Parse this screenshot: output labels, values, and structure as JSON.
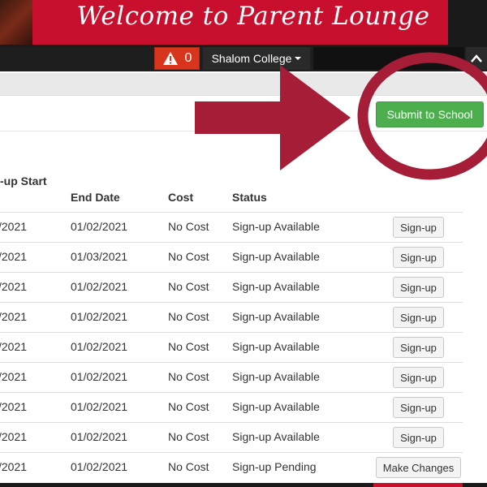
{
  "banner": {
    "title": "Welcome to Parent Lounge"
  },
  "topnav": {
    "alert_count": "0",
    "school_name": "Shalom College"
  },
  "actions": {
    "submit_label": "Submit to School"
  },
  "table": {
    "headers": {
      "start": "-up Start",
      "end": "End Date",
      "cost": "Cost",
      "status": "Status"
    },
    "rows": [
      {
        "start": "/2021",
        "end": "01/02/2021",
        "cost": "No Cost",
        "status": "Sign-up Available",
        "action": "Sign-up"
      },
      {
        "start": "/2021",
        "end": "01/03/2021",
        "cost": "No Cost",
        "status": "Sign-up Available",
        "action": "Sign-up"
      },
      {
        "start": "/2021",
        "end": "01/02/2021",
        "cost": "No Cost",
        "status": "Sign-up Available",
        "action": "Sign-up"
      },
      {
        "start": "/2021",
        "end": "01/02/2021",
        "cost": "No Cost",
        "status": "Sign-up Available",
        "action": "Sign-up"
      },
      {
        "start": "/2021",
        "end": "01/02/2021",
        "cost": "No Cost",
        "status": "Sign-up Available",
        "action": "Sign-up"
      },
      {
        "start": "/2021",
        "end": "01/02/2021",
        "cost": "No Cost",
        "status": "Sign-up Available",
        "action": "Sign-up"
      },
      {
        "start": "/2021",
        "end": "01/02/2021",
        "cost": "No Cost",
        "status": "Sign-up Available",
        "action": "Sign-up"
      },
      {
        "start": "/2021",
        "end": "01/02/2021",
        "cost": "No Cost",
        "status": "Sign-up Available",
        "action": "Sign-up"
      },
      {
        "start": "/2021",
        "end": "01/02/2021",
        "cost": "No Cost",
        "status": "Sign-up Pending",
        "action": "Make Changes"
      }
    ]
  },
  "colors": {
    "brand_red": "#c8102e",
    "annotation": "#a51d36",
    "submit_green": "#4cae4c",
    "alert_red": "#d9341c"
  }
}
